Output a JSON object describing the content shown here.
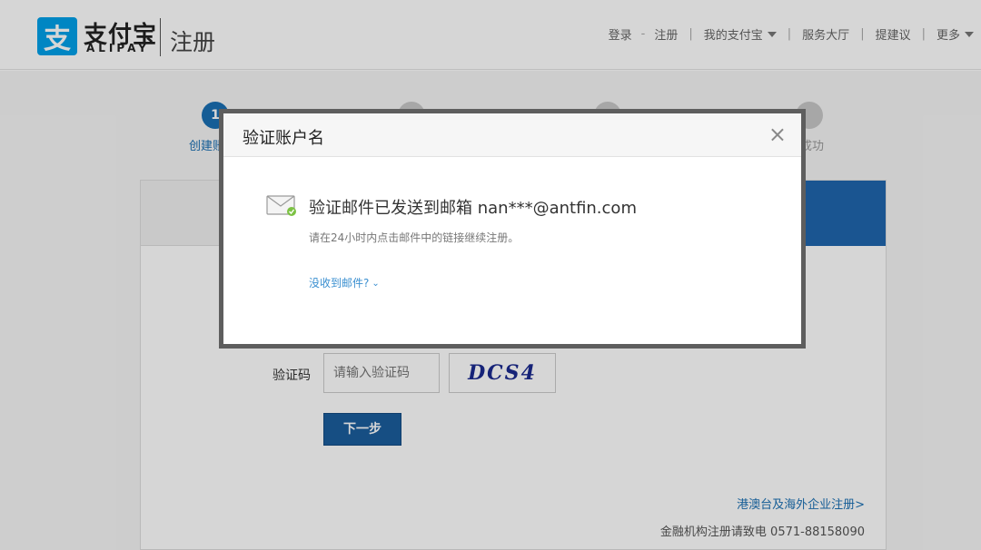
{
  "header": {
    "logo_mark": "支",
    "logo_cn": "支付宝",
    "logo_en": "ALIPAY",
    "sub_title": "注册",
    "nav": {
      "login": "登录",
      "dash": "-",
      "register": "注册",
      "sep": "|",
      "my_alipay": "我的支付宝",
      "service_hall": "服务大厅",
      "suggest": "提建议",
      "more": "更多"
    }
  },
  "steps": {
    "step1_number": "1",
    "step1_label": "创建账",
    "step4_label": "成功"
  },
  "form": {
    "captcha_label": "验证码",
    "captcha_placeholder": "请输入验证码",
    "captcha_image_text": "DCS4",
    "next_button": "下一步",
    "hk_link": "港澳台及海外企业注册>",
    "hotline": "金融机构注册请致电 0571-88158090"
  },
  "modal": {
    "title": "验证账户名",
    "close": "×",
    "message": "验证邮件已发送到邮箱 nan***@antfin.com",
    "hint": "请在24小时内点击邮件中的链接继续注册。",
    "no_mail_link": "没收到邮件?"
  },
  "colors": {
    "brand_blue": "#00a0e9",
    "primary_button": "#1b5d9c",
    "link": "#3a8fd0"
  }
}
